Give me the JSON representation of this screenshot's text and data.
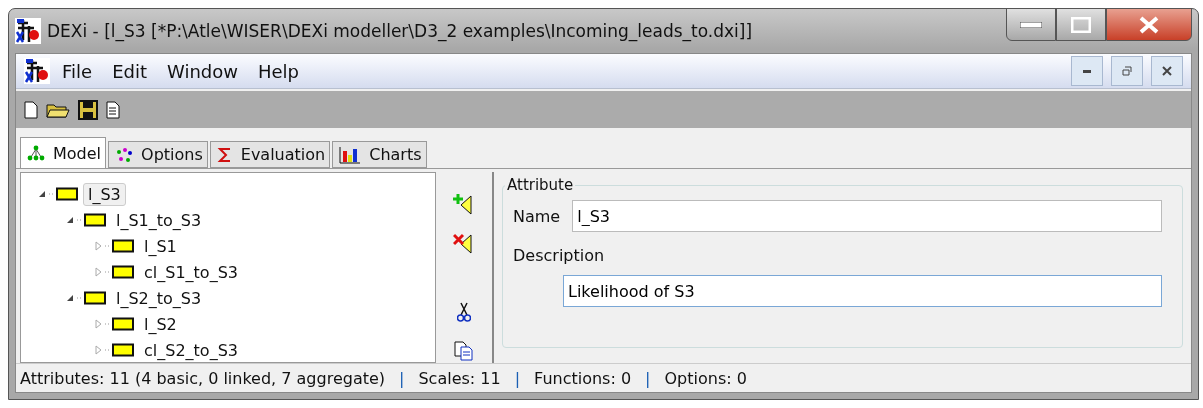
{
  "window": {
    "title": "DEXi - [l_S3 [*P:\\Atle\\WISER\\DEXi modeller\\D3_2 examples\\Incoming_leads_to.dxi]]"
  },
  "menu": [
    "File",
    "Edit",
    "Window",
    "Help"
  ],
  "tabs": [
    {
      "label": "Model",
      "selected": true,
      "kind": "model"
    },
    {
      "label": "Options",
      "selected": false,
      "kind": "options"
    },
    {
      "label": "Evaluation",
      "selected": false,
      "kind": "evaluation"
    },
    {
      "label": "Charts",
      "selected": false,
      "kind": "charts"
    }
  ],
  "tree": [
    {
      "label": "l_S3",
      "selected": true,
      "expanded": true,
      "children": [
        {
          "label": "l_S1_to_S3",
          "selected": false,
          "expanded": true,
          "children": [
            {
              "label": "l_S1",
              "selected": false,
              "expanded": false
            },
            {
              "label": "cl_S1_to_S3",
              "selected": false,
              "expanded": false
            }
          ]
        },
        {
          "label": "l_S2_to_S3",
          "selected": false,
          "expanded": true,
          "children": [
            {
              "label": "l_S2",
              "selected": false,
              "expanded": false
            },
            {
              "label": "cl_S2_to_S3",
              "selected": false,
              "expanded": false
            }
          ]
        }
      ]
    }
  ],
  "attribute": {
    "title": "Attribute",
    "name_label": "Name",
    "name_value": "l_S3",
    "description_label": "Description",
    "description_value": "Likelihood of S3"
  },
  "status_bar": {
    "separator": "|",
    "items": [
      "Attributes: 11 (4 basic, 0 linked, 7 aggregate)",
      "Scales: 11",
      "Functions: 0",
      "Options: 0"
    ]
  }
}
